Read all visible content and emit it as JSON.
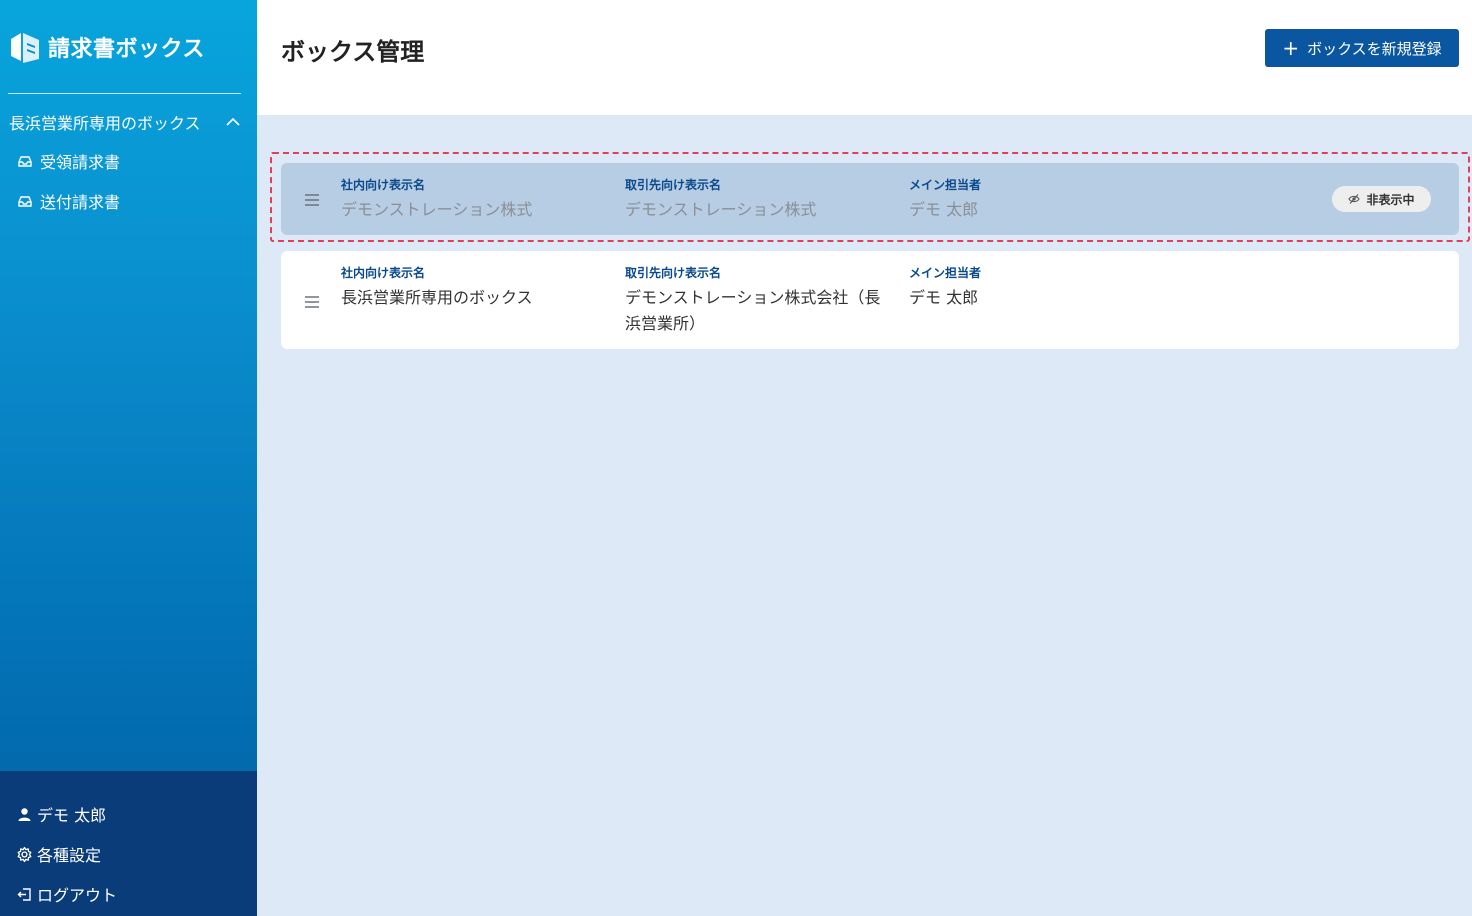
{
  "sidebar": {
    "logo_text": "請求書ボックス",
    "group_label": "長浜営業所専用のボックス",
    "items": [
      {
        "label": "受領請求書",
        "icon": "inbox-icon"
      },
      {
        "label": "送付請求書",
        "icon": "inbox-icon"
      }
    ],
    "bottom": [
      {
        "label": "デモ 太郎",
        "icon": "user-icon"
      },
      {
        "label": "各種設定",
        "icon": "gear-icon"
      },
      {
        "label": "ログアウト",
        "icon": "logout-icon"
      }
    ]
  },
  "header": {
    "title": "ボックス管理",
    "add_button_label": "ボックスを新規登録"
  },
  "boxes": [
    {
      "internal_label": "社内向け表示名",
      "internal_name": "デモンストレーション株式",
      "partner_label": "取引先向け表示名",
      "partner_name": "デモンストレーション株式",
      "owner_label": "メイン担当者",
      "owner_name": "デモ 太郎",
      "badge": "非表示中"
    },
    {
      "internal_label": "社内向け表示名",
      "internal_name": "長浜営業所専用のボックス",
      "partner_label": "取引先向け表示名",
      "partner_name": "デモンストレーション株式会社（長浜営業所）",
      "owner_label": "メイン担当者",
      "owner_name": "デモ 太郎"
    }
  ],
  "colors": {
    "primary": "#0a56a0",
    "highlight": "#e0405a",
    "label": "#0a4a8c"
  }
}
